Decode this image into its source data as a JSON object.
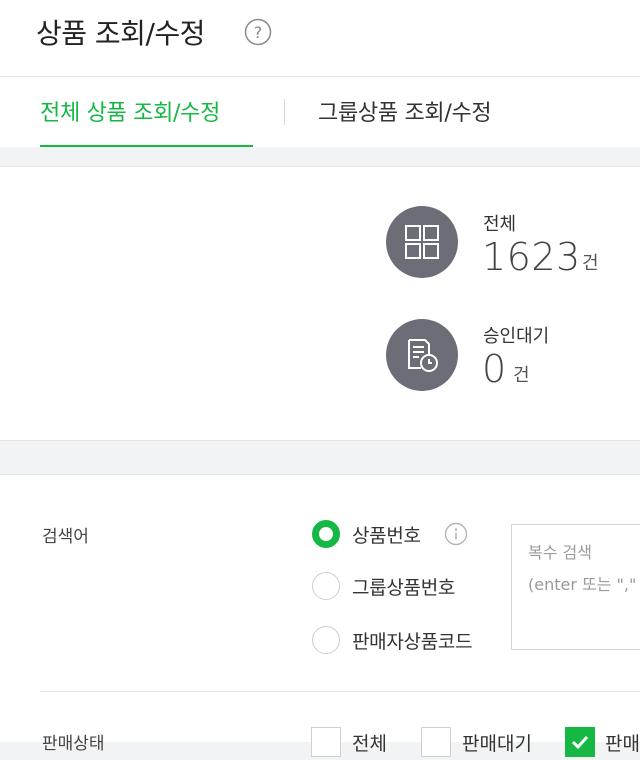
{
  "header": {
    "title": "상품 조회/수정",
    "help_icon": "question-circle-icon"
  },
  "tabs": [
    {
      "label": "전체 상품 조회/수정",
      "active": true
    },
    {
      "label": "그룹상품 조회/수정",
      "active": false
    }
  ],
  "stats": [
    {
      "label": "전체",
      "value": "1623",
      "unit": "건",
      "icon": "grid-icon"
    },
    {
      "label": "승인대기",
      "value": "0",
      "unit": "건",
      "icon": "document-clock-icon"
    }
  ],
  "search": {
    "keyword_label": "검색어",
    "options": [
      {
        "label": "상품번호",
        "checked": true
      },
      {
        "label": "그룹상품번호",
        "checked": false
      },
      {
        "label": "판매자상품코드",
        "checked": false
      }
    ],
    "textarea_line1": "복수 검색",
    "textarea_line2": "(enter 또는 \",\"",
    "sale_status_label": "판매상태",
    "status_options": [
      {
        "label": "전체",
        "checked": false
      },
      {
        "label": "판매대기",
        "checked": false
      },
      {
        "label": "판매중",
        "checked": true
      }
    ]
  },
  "colors": {
    "accent": "#14b843",
    "icon_circle": "#6b6e76"
  }
}
